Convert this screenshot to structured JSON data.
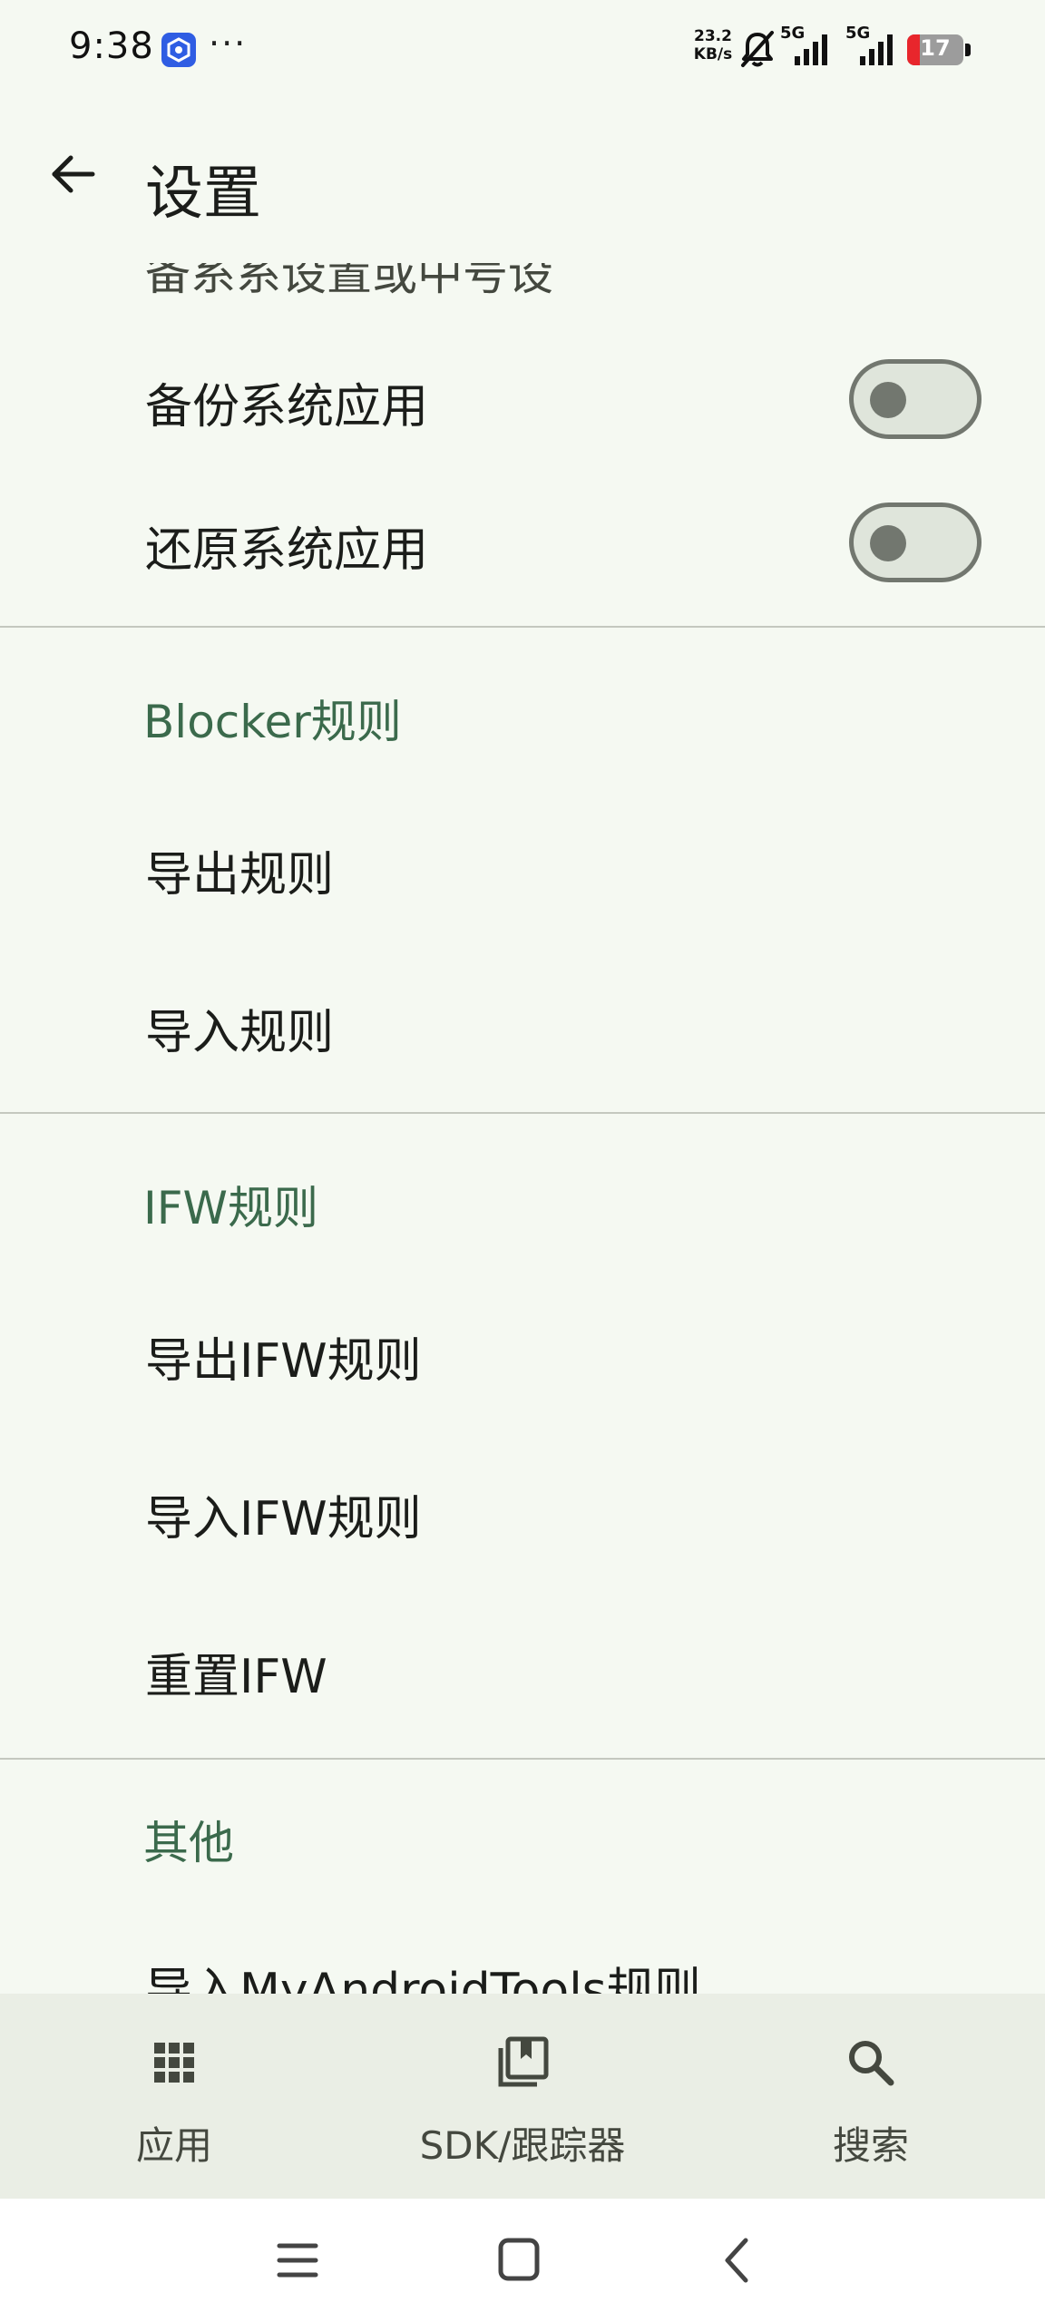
{
  "status_bar": {
    "time": "9:38",
    "more": "···",
    "net_speed_value": "23.2",
    "net_speed_unit": "KB/s",
    "signal_1_label": "5G",
    "signal_2_label": "5G",
    "battery_level": "17"
  },
  "top_bar": {
    "title": "设置"
  },
  "content": {
    "partial_top_text": "备系系设置或中号设",
    "rows": {
      "backup_system_apps": {
        "label": "备份系统应用",
        "enabled": false
      },
      "restore_system_apps": {
        "label": "还原系统应用",
        "enabled": false
      }
    },
    "sections": {
      "blocker_rules": {
        "header": "Blocker规则",
        "items": [
          "导出规则",
          "导入规则"
        ]
      },
      "ifw_rules": {
        "header": "IFW规则",
        "items": [
          "导出IFW规则",
          "导入IFW规则",
          "重置IFW"
        ]
      },
      "other": {
        "header": "其他",
        "partial_item": "导入MyAndroidTools规则"
      }
    }
  },
  "bottom_nav": {
    "items": [
      {
        "label": "应用",
        "icon": "grid-apps-icon"
      },
      {
        "label": "SDK/跟踪器",
        "icon": "library-books-icon"
      },
      {
        "label": "搜索",
        "icon": "search-icon"
      }
    ]
  },
  "system_nav": {
    "buttons": [
      "menu-icon",
      "home-icon",
      "back-icon"
    ]
  },
  "colors": {
    "background": "#f5f9f2",
    "section_header": "#3b6a4c",
    "bottom_nav_bg": "#eaeee5",
    "switch_outline": "#72776f",
    "battery_low": "#e8262c"
  }
}
